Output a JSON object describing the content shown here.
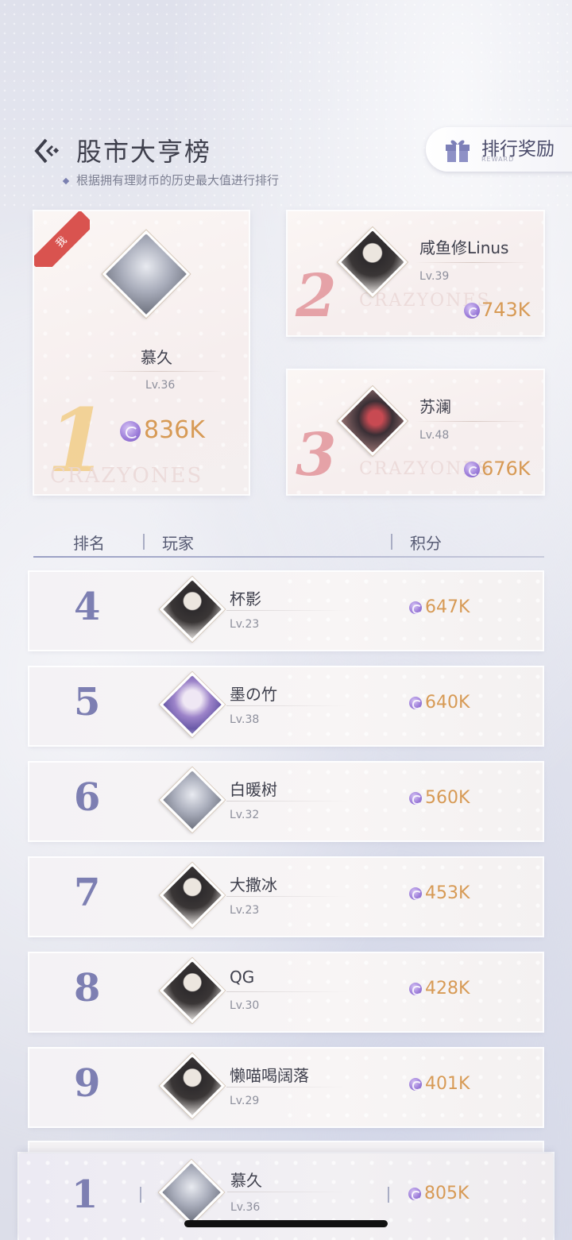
{
  "header": {
    "title": "股市大亨榜",
    "subtitle": "根据拥有理财币的历史最大值进行排行",
    "reward_label": "排行奖励",
    "reward_sub": "REWARD"
  },
  "top3": [
    {
      "rank": "1",
      "name": "慕久",
      "level": "Lv.36",
      "score": "836K",
      "badge": "我",
      "avatar": "silver-hair-avatar"
    },
    {
      "rank": "2",
      "name": "咸鱼修Linus",
      "level": "Lv.39",
      "score": "743K",
      "avatar": "dark-hair-avatar"
    },
    {
      "rank": "3",
      "name": "苏澜",
      "level": "Lv.48",
      "score": "676K",
      "avatar": "red-dress-avatar"
    }
  ],
  "table_header": {
    "rank": "排名",
    "player": "玩家",
    "score": "积分"
  },
  "rows": [
    {
      "rank": "4",
      "name": "杯影",
      "level": "Lv.23",
      "score": "647K",
      "avatar": "dark-hair-avatar"
    },
    {
      "rank": "5",
      "name": "墨の竹",
      "level": "Lv.38",
      "score": "640K",
      "avatar": "purple-hair-avatar"
    },
    {
      "rank": "6",
      "name": "白暖树",
      "level": "Lv.32",
      "score": "560K",
      "avatar": "silver-hair-avatar"
    },
    {
      "rank": "7",
      "name": "大撒冰",
      "level": "Lv.23",
      "score": "453K",
      "avatar": "dark-hair-avatar"
    },
    {
      "rank": "8",
      "name": "QG",
      "level": "Lv.30",
      "score": "428K",
      "avatar": "dark-hair-avatar"
    },
    {
      "rank": "9",
      "name": "懒喵喝阔落",
      "level": "Lv.29",
      "score": "401K",
      "avatar": "dark-hair-avatar"
    }
  ],
  "self": {
    "rank": "1",
    "name": "慕久",
    "level": "Lv.36",
    "score": "805K",
    "avatar": "silver-hair-avatar"
  },
  "watermark": "CRAZYONES",
  "colors": {
    "accent": "#7d7fb2",
    "score": "#d79a55",
    "ribbon": "#d9534f"
  }
}
